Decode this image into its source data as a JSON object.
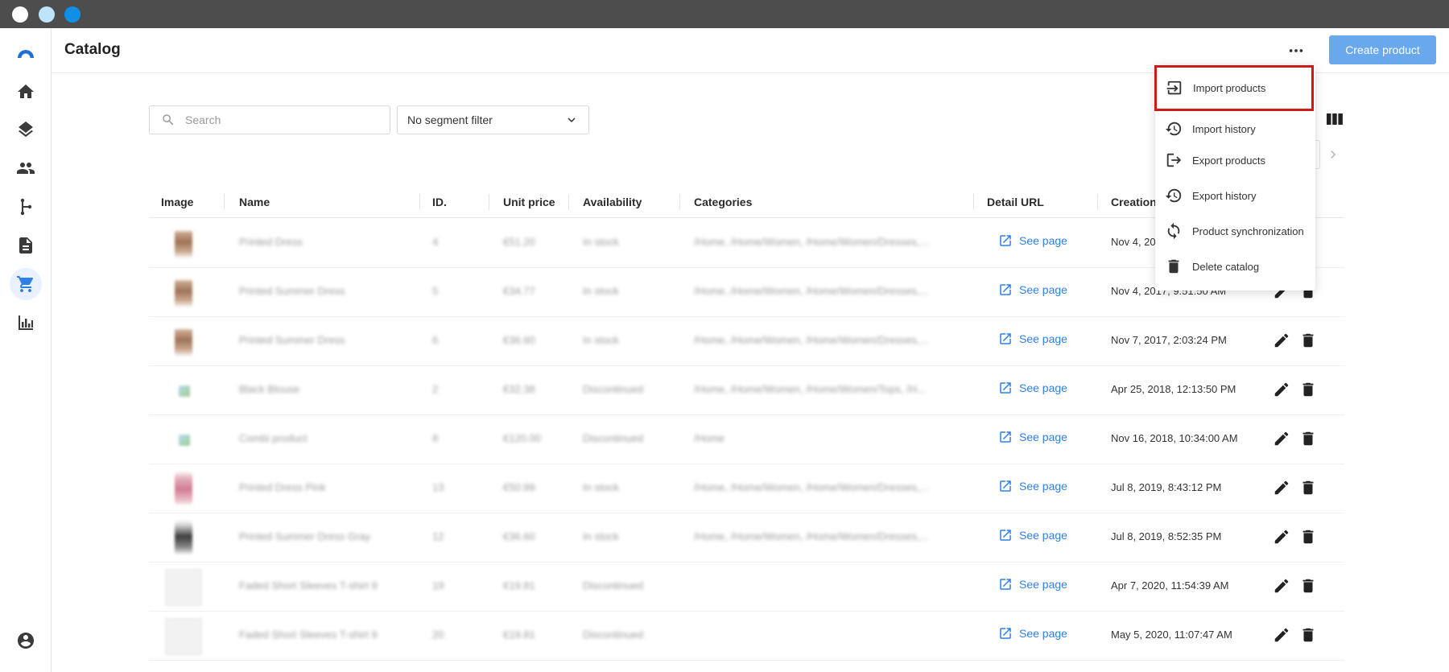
{
  "window": {
    "dots": [
      "close",
      "minimize",
      "maximize"
    ]
  },
  "sidebar": {
    "items": [
      {
        "name": "logo",
        "icon": "brand-logo"
      },
      {
        "name": "home",
        "icon": "home-icon"
      },
      {
        "name": "layers",
        "icon": "layers-icon"
      },
      {
        "name": "people",
        "icon": "people-icon"
      },
      {
        "name": "flows",
        "icon": "branch-icon"
      },
      {
        "name": "documents",
        "icon": "document-icon"
      },
      {
        "name": "catalog",
        "icon": "cart-icon",
        "active": true
      },
      {
        "name": "analytics",
        "icon": "bar-chart-icon"
      },
      {
        "name": "account",
        "icon": "account-circle-icon"
      }
    ]
  },
  "header": {
    "title": "Catalog",
    "create_label": "Create product",
    "more_icon": "more-horizontal-icon"
  },
  "toolbar": {
    "search_placeholder": "Search",
    "segment_filter": "No segment filter"
  },
  "table": {
    "columns": [
      "Image",
      "Name",
      "ID.",
      "Unit price",
      "Availability",
      "Categories",
      "Detail URL",
      "Creation"
    ],
    "link_label": "See page",
    "rows": [
      {
        "image": "dress",
        "name": "Printed Dress",
        "id": "4",
        "price": "€51.20",
        "availability": "In stock",
        "categories": "/Home, /Home/Women, /Home/Women/Dresses,...",
        "created": "Nov 4, 20"
      },
      {
        "image": "dress",
        "name": "Printed Summer Dress",
        "id": "5",
        "price": "€34.77",
        "availability": "In stock",
        "categories": "/Home, /Home/Women, /Home/Women/Dresses,...",
        "created": "Nov 4, 2017, 9:51:50 AM"
      },
      {
        "image": "dress",
        "name": "Printed Summer Dress",
        "id": "6",
        "price": "€36.60",
        "availability": "In stock",
        "categories": "/Home, /Home/Women, /Home/Women/Dresses,...",
        "created": "Nov 7, 2017, 2:03:24 PM"
      },
      {
        "image": "tiny",
        "name": "Black Blouse",
        "id": "2",
        "price": "€32.38",
        "availability": "Discontinued",
        "categories": "/Home, /Home/Women, /Home/Women/Tops, /H...",
        "created": "Apr 25, 2018, 12:13:50 PM"
      },
      {
        "image": "tiny",
        "name": "Combi product",
        "id": "8",
        "price": "€120.00",
        "availability": "Discontinued",
        "categories": "/Home",
        "created": "Nov 16, 2018, 10:34:00 AM"
      },
      {
        "image": "pink",
        "name": "Printed Dress Pink",
        "id": "13",
        "price": "€50.99",
        "availability": "In stock",
        "categories": "/Home, /Home/Women, /Home/Women/Dresses,...",
        "created": "Jul 8, 2019, 8:43:12 PM"
      },
      {
        "image": "dark",
        "name": "Printed Summer Dress Gray",
        "id": "12",
        "price": "€36.60",
        "availability": "In stock",
        "categories": "/Home, /Home/Women, /Home/Women/Dresses,...",
        "created": "Jul 8, 2019, 8:52:35 PM"
      },
      {
        "image": "placeholder",
        "name": "Faded Short Sleeves T-shirt 9",
        "id": "19",
        "price": "€19.81",
        "availability": "Discontinued",
        "categories": "",
        "created": "Apr 7, 2020, 11:54:39 AM"
      },
      {
        "image": "placeholder",
        "name": "Faded Short Sleeves T-shirt 9",
        "id": "20",
        "price": "€19.81",
        "availability": "Discontinued",
        "categories": "",
        "created": "May 5, 2020, 11:07:47 AM"
      }
    ]
  },
  "menu": {
    "items": [
      {
        "label": "Import products",
        "icon": "import-icon",
        "highlighted": true
      },
      {
        "label": "Import history",
        "icon": "history-icon"
      },
      {
        "label": "Export products",
        "icon": "export-icon"
      },
      {
        "label": "Export history",
        "icon": "history-icon"
      },
      {
        "label": "Product synchronization",
        "icon": "sync-icon"
      },
      {
        "label": "Delete catalog",
        "icon": "trash-icon"
      }
    ]
  },
  "colors": {
    "accent": "#2f80e6",
    "primary_button": "#6aa8ee",
    "highlight_border": "#d01a1a",
    "titlebar": "#4d4d4d"
  }
}
